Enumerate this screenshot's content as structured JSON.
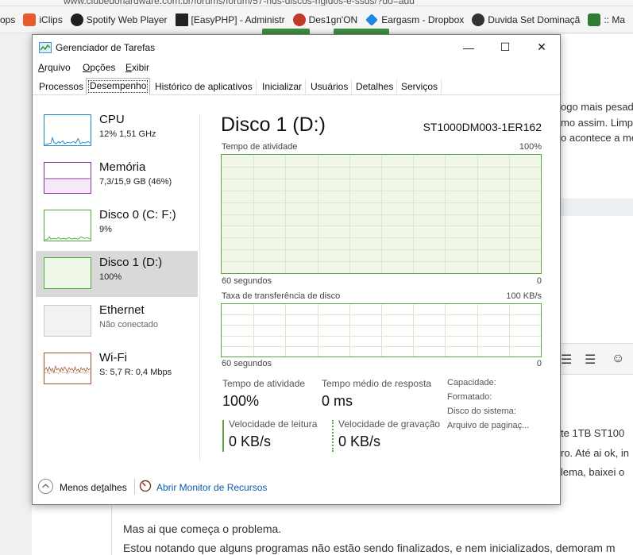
{
  "browser": {
    "url": "www.clubedohardware.com.br/forums/forum/57-hds-discos-rigidos-e-ssds/?do=add",
    "bookmarks": [
      {
        "label": "ops",
        "icon": "apps-icon",
        "color": "#ffffff"
      },
      {
        "label": "iClips",
        "icon": "iclips-icon",
        "color": "#e85a2a"
      },
      {
        "label": "Spotify Web Player",
        "icon": "spotify-icon",
        "color": "#1f1f1f"
      },
      {
        "label": "[EasyPHP] - Administr",
        "icon": "easyphp-icon",
        "color": "#222222"
      },
      {
        "label": "Des1gn'ON",
        "icon": "designon-icon",
        "color": "#c0392b"
      },
      {
        "label": "Eargasm - Dropbox",
        "icon": "dropbox-icon",
        "color": "#1e88e5"
      },
      {
        "label": "Duvida Set Dominaçã",
        "icon": "wordpress-icon",
        "color": "#333333"
      },
      {
        "label": ":: Ma",
        "icon": "leaf-icon",
        "color": "#2e7d32"
      }
    ],
    "page_fragments": [
      "ogo mais pesado",
      "mo assim. Limp",
      "o acontece a me",
      "te 1TB ST100",
      "ro. Até ai ok, in",
      "lema, baixei o"
    ],
    "paragraph_1": "Mas ai que começa o problema.",
    "paragraph_2": "Estou notando que alguns programas não estão sendo finalizados, e nem inicializados, demoram m",
    "editor_icons": [
      "align-right-icon",
      "align-justify-icon",
      "emoji-icon"
    ]
  },
  "window": {
    "title": "Gerenciador de Tarefas",
    "controls": {
      "minimize": "—",
      "maximize": "☐",
      "close": "✕"
    },
    "menu": [
      {
        "accel": "A",
        "rest": "rquivo"
      },
      {
        "accel": "O",
        "rest": "pções"
      },
      {
        "accel": "E",
        "rest": "xibir"
      }
    ],
    "tabs": [
      "Processos",
      "Desempenho",
      "Histórico de aplicativos",
      "Inicializar",
      "Usuários",
      "Detalhes",
      "Serviços"
    ],
    "active_tab": "Desempenho"
  },
  "sidebar": {
    "items": [
      {
        "name": "CPU",
        "value": "12%  1,51 GHz",
        "color": "#1a86c8",
        "fill": "#ffffff"
      },
      {
        "name": "Memória",
        "value": "7,3/15,9 GB (46%)",
        "color": "#8b2d9e",
        "fill": "#f4e9f6"
      },
      {
        "name": "Disco 0 (C: F:)",
        "value": "9%",
        "color": "#4caa3b",
        "fill": "#ffffff"
      },
      {
        "name": "Disco 1 (D:)",
        "value": "100%",
        "color": "#4caa3b",
        "fill": "#eef7e6"
      },
      {
        "name": "Ethernet",
        "value": "Não conectado",
        "color": "#c8c8c8",
        "fill": "#f2f2f2"
      },
      {
        "name": "Wi-Fi",
        "value": "S: 5,7  R: 0,4 Mbps",
        "color": "#a0522d",
        "fill": "#ffffff"
      }
    ],
    "selected": "Disco 1 (D:)"
  },
  "detail": {
    "title": "Disco 1 (D:)",
    "model": "ST1000DM003-1ER162",
    "activity_label": "Tempo de atividade",
    "activity_max": "100%",
    "activity_time": "60 segundos",
    "activity_min": "0",
    "transfer_label": "Taxa de transferência de disco",
    "transfer_max": "100 KB/s",
    "transfer_time": "60 segundos",
    "transfer_min": "0",
    "stats": {
      "active_time_label": "Tempo de atividade",
      "active_time_value": "100%",
      "response_label": "Tempo médio de resposta",
      "response_value": "0 ms",
      "read_label": "Velocidade de leitura",
      "read_value": "0 KB/s",
      "write_label": "Velocidade de gravação",
      "write_value": "0 KB/s"
    },
    "properties": [
      "Capacidade:",
      "Formatado:",
      "Disco do sistema:",
      "Arquivo de paginaç..."
    ]
  },
  "footer": {
    "less_details_pre": "Menos de",
    "less_details_accel": "t",
    "less_details_post": "alhes",
    "resource_monitor": "Abrir Monitor de Recursos"
  }
}
